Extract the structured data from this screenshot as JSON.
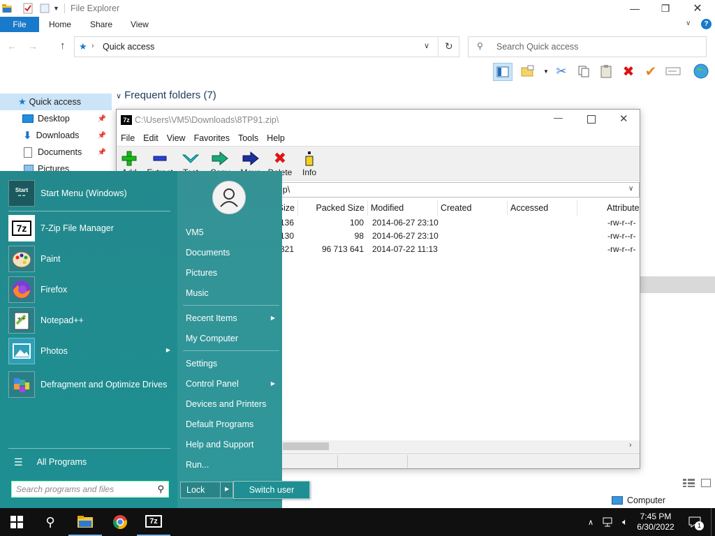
{
  "explorer": {
    "title": "File Explorer",
    "tabs": [
      "File",
      "Home",
      "Share",
      "View"
    ],
    "address": "Quick access",
    "search_placeholder": "Search Quick access",
    "nav": {
      "quick_access": "Quick access",
      "items": [
        "Desktop",
        "Downloads",
        "Documents",
        "Pictures"
      ]
    },
    "frequent_folders": "Frequent folders (7)",
    "status_location": "Computer"
  },
  "zip": {
    "title": "C:\\Users\\VM5\\Downloads\\8TP91.zip\\",
    "menu": [
      "File",
      "Edit",
      "View",
      "Favorites",
      "Tools",
      "Help"
    ],
    "tools": [
      "Add",
      "Extract",
      "Test",
      "Copy",
      "Move",
      "Delete",
      "Info"
    ],
    "path": "ip\\",
    "columns": [
      "Size",
      "Packed Size",
      "Modified",
      "Created",
      "Accessed",
      "Attribute"
    ],
    "rows": [
      {
        "size": "136",
        "packed": "100",
        "modified": "2014-06-27 23:10",
        "attr": "-rw-r--r-"
      },
      {
        "size": "130",
        "packed": "98",
        "modified": "2014-06-27 23:10",
        "attr": "-rw-r--r-"
      },
      {
        "size": "321",
        "packed": "96 713 641",
        "modified": "2014-07-22 11:13",
        "attr": "-rw-r--r-"
      }
    ]
  },
  "start": {
    "apps": [
      {
        "label": "Start Menu (Windows)"
      },
      {
        "label": "7-Zip File Manager"
      },
      {
        "label": "Paint"
      },
      {
        "label": "Firefox"
      },
      {
        "label": "Notepad++"
      },
      {
        "label": "Photos"
      },
      {
        "label": "Defragment and Optimize Drives"
      }
    ],
    "all_programs": "All Programs",
    "search_placeholder": "Search programs and files",
    "right": {
      "user": "VM5",
      "documents": "Documents",
      "pictures": "Pictures",
      "music": "Music",
      "recent": "Recent Items",
      "computer": "My Computer",
      "settings": "Settings",
      "control_panel": "Control Panel",
      "devices": "Devices and Printers",
      "default_programs": "Default Programs",
      "help": "Help and Support",
      "run": "Run..."
    },
    "lock": "Lock",
    "switch_user": "Switch user"
  },
  "taskbar": {
    "time": "7:45 PM",
    "date": "6/30/2022",
    "notification_count": "1"
  },
  "colors": {
    "start_bg": "#1f8d90",
    "ribbon_file": "#1979ca",
    "taskbar": "#101010"
  }
}
